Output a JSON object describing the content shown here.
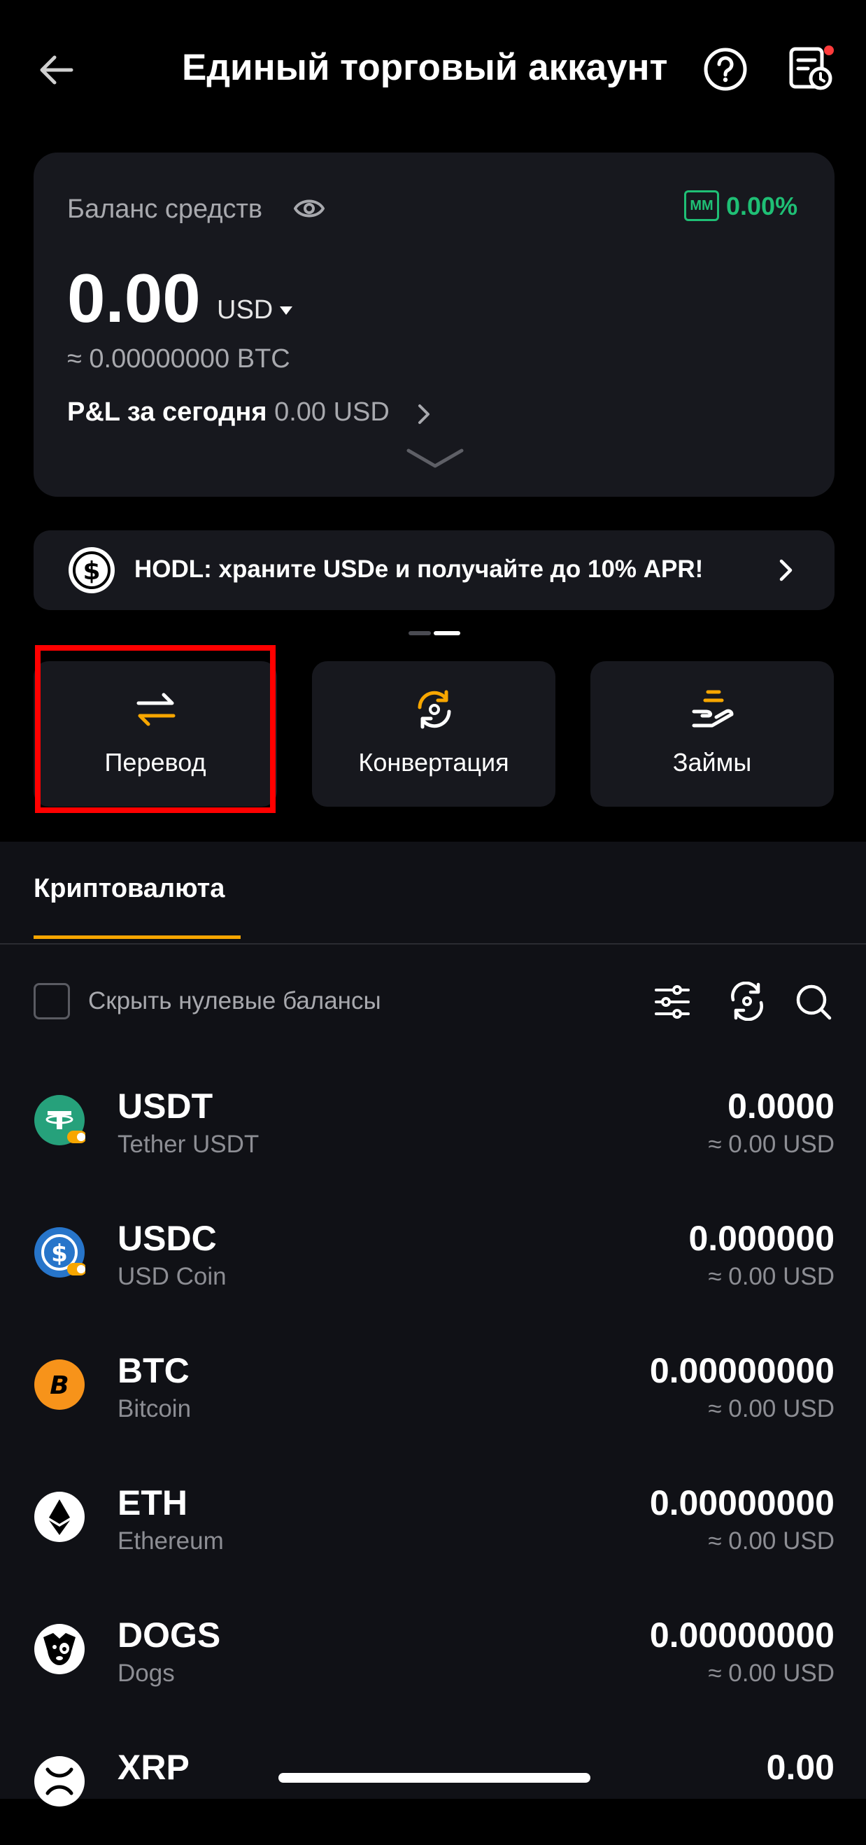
{
  "header": {
    "title": "Единый торговый аккаунт"
  },
  "balance": {
    "label": "Баланс средств",
    "mm_badge": "MM",
    "mm_value": "0.00%",
    "amount": "0.00",
    "currency": "USD",
    "btc_equiv": "≈ 0.00000000 BTC",
    "pnl_label": "P&L за сегодня",
    "pnl_value": "0.00 USD"
  },
  "banner": {
    "text": "HODL: храните USDe и получайте до 10% APR!"
  },
  "actions": [
    {
      "label": "Перевод",
      "icon": "transfer-icon"
    },
    {
      "label": "Конвертация",
      "icon": "convert-icon"
    },
    {
      "label": "Займы",
      "icon": "loan-icon"
    }
  ],
  "tabs": {
    "crypto": "Криптовалюта"
  },
  "filters": {
    "hide_zero_label": "Скрыть нулевые балансы"
  },
  "assets": [
    {
      "symbol": "USDT",
      "name": "Tether USDT",
      "amount": "0.0000",
      "usd": "≈ 0.00 USD"
    },
    {
      "symbol": "USDC",
      "name": "USD Coin",
      "amount": "0.000000",
      "usd": "≈ 0.00 USD"
    },
    {
      "symbol": "BTC",
      "name": "Bitcoin",
      "amount": "0.00000000",
      "usd": "≈ 0.00 USD"
    },
    {
      "symbol": "ETH",
      "name": "Ethereum",
      "amount": "0.00000000",
      "usd": "≈ 0.00 USD"
    },
    {
      "symbol": "DOGS",
      "name": "Dogs",
      "amount": "0.00000000",
      "usd": "≈ 0.00 USD"
    },
    {
      "symbol": "XRP",
      "name": "",
      "amount": "0.00",
      "usd": ""
    }
  ],
  "colors": {
    "accent": "#f7a600",
    "positive": "#1fbf75",
    "card": "#17181e",
    "highlight": "#ff0000"
  }
}
